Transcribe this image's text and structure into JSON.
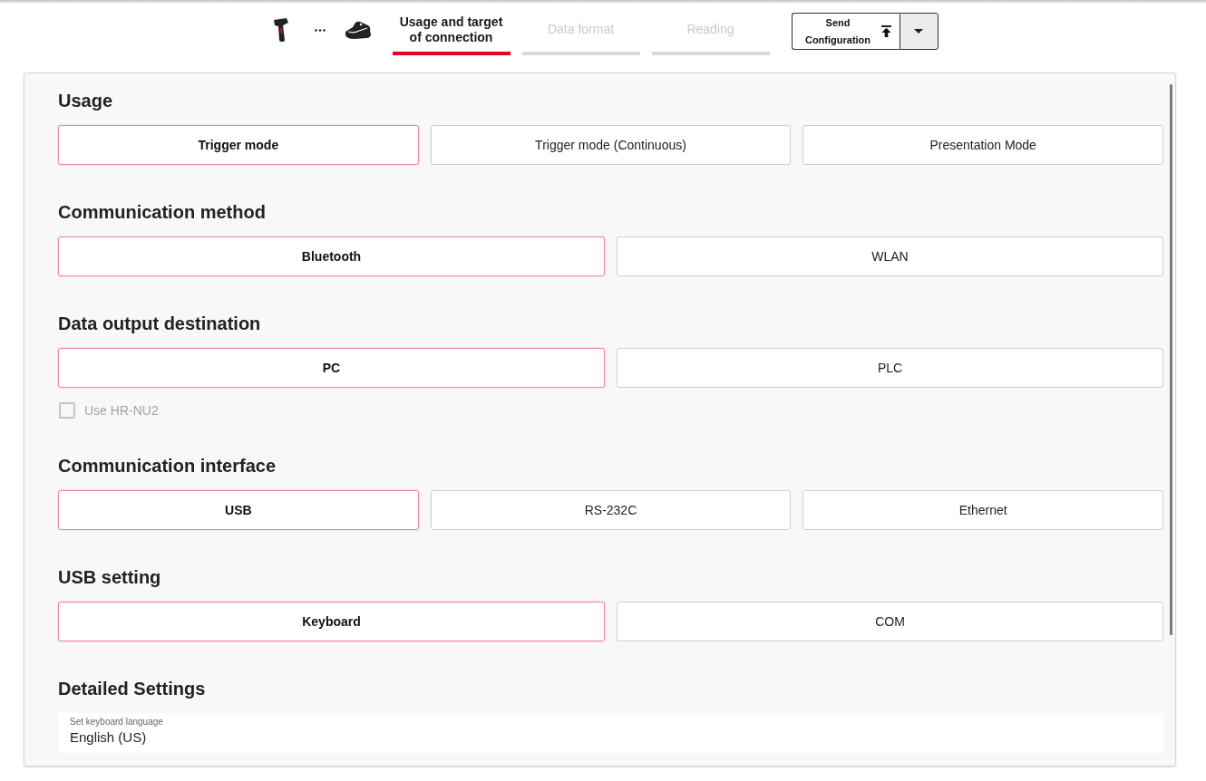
{
  "steps": [
    {
      "label": "Usage and target of connection",
      "selected": true
    },
    {
      "label": "Data format",
      "selected": false
    },
    {
      "label": "Reading",
      "selected": false
    }
  ],
  "send_button": {
    "label": "Send Configuration"
  },
  "sections": [
    {
      "title": "Usage",
      "options": [
        {
          "label": "Trigger mode",
          "selected": true
        },
        {
          "label": "Trigger mode (Continuous)",
          "selected": false
        },
        {
          "label": "Presentation Mode",
          "selected": false
        }
      ]
    },
    {
      "title": "Communication method",
      "options": [
        {
          "label": "Bluetooth",
          "selected": true
        },
        {
          "label": "WLAN",
          "selected": false
        }
      ]
    },
    {
      "title": "Data output destination",
      "options": [
        {
          "label": "PC",
          "selected": true
        },
        {
          "label": "PLC",
          "selected": false
        }
      ],
      "checkbox": {
        "label": "Use HR-NU2",
        "checked": false,
        "disabled": true
      }
    },
    {
      "title": "Communication interface",
      "options": [
        {
          "label": "USB",
          "selected": true
        },
        {
          "label": "RS-232C",
          "selected": false
        },
        {
          "label": "Ethernet",
          "selected": false
        }
      ]
    },
    {
      "title": "USB setting",
      "options": [
        {
          "label": "Keyboard",
          "selected": true
        },
        {
          "label": "COM",
          "selected": false
        }
      ]
    },
    {
      "title": "Detailed Settings",
      "field": {
        "label": "Set keyboard language",
        "value": "English (US)"
      }
    }
  ]
}
